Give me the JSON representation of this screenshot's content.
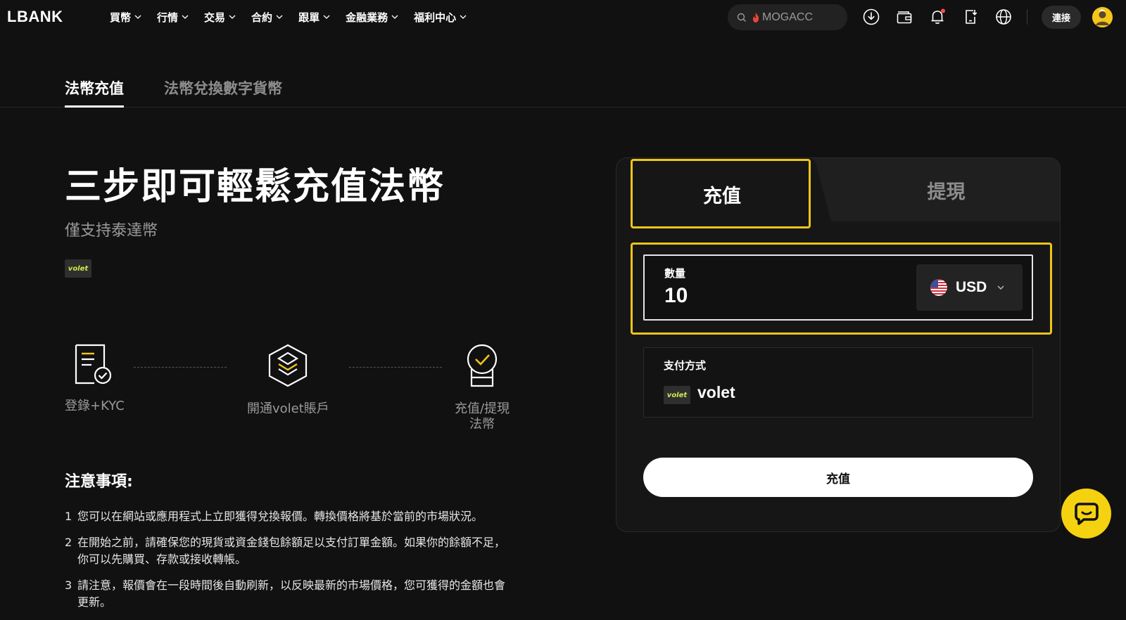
{
  "brand": {
    "logo": "LBANK"
  },
  "nav": {
    "items": [
      {
        "label": "買幣"
      },
      {
        "label": "行情"
      },
      {
        "label": "交易"
      },
      {
        "label": "合約"
      },
      {
        "label": "跟單"
      },
      {
        "label": "金融業務"
      },
      {
        "label": "福利中心"
      }
    ],
    "search_hint": "MOGACC",
    "connect_label": "連接",
    "icons": [
      "download-icon",
      "wallet-icon",
      "bell-icon",
      "phone-download-icon",
      "globe-icon"
    ]
  },
  "subtabs": {
    "active": "法幣充值",
    "inactive": "法幣兌換數字貨幣"
  },
  "hero": {
    "title": "三步即可輕鬆充值法幣",
    "subtitle": "僅支持泰達幣",
    "badge": "volet"
  },
  "steps": [
    {
      "label": "登錄+KYC",
      "icon": "document-check-icon"
    },
    {
      "label": "開通volet賬戶",
      "icon": "layers-icon"
    },
    {
      "label": "充值/提現法幣",
      "icon": "badge-check-icon"
    }
  ],
  "notes": {
    "title": "注意事項:",
    "items": [
      {
        "num": "1",
        "text": "您可以在網站或應用程式上立即獲得兌換報價。轉換價格將基於當前的市場狀況。"
      },
      {
        "num": "2",
        "text": "在開始之前，請確保您的現貨或資金錢包餘額足以支付訂單金額。如果你的餘額不足，你可以先購買、存款或接收轉帳。"
      },
      {
        "num": "3",
        "text": "請注意，報價會在一段時間後自動刷新，以反映最新的市場價格，您可獲得的金額也會更新。"
      }
    ]
  },
  "card": {
    "tab_deposit": "充值",
    "tab_withdraw": "提現",
    "amount_label": "數量",
    "amount_value": "10",
    "currency": "USD",
    "payment_label": "支付方式",
    "payment_badge": "volet",
    "payment_name": "volet",
    "submit_label": "充值"
  },
  "colors": {
    "background": "#111111",
    "highlight": "#f0c419",
    "chat": "#f5d20f",
    "brand_badge_text": "#d4e84c"
  }
}
